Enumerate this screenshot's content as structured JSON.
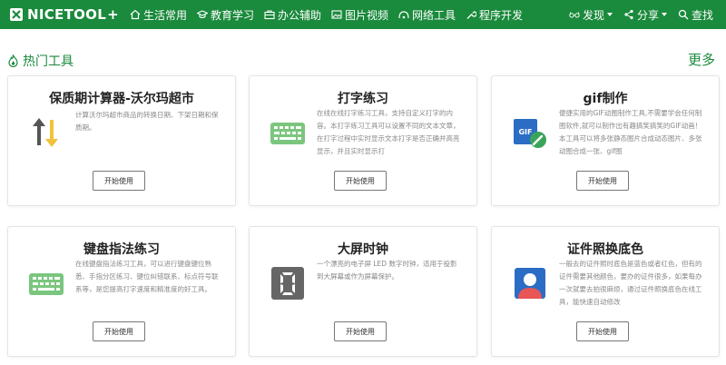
{
  "header": {
    "logo_text": "NICETOOL",
    "logo_plus": "+",
    "nav": [
      {
        "label": "生活常用"
      },
      {
        "label": "教育学习"
      },
      {
        "label": "办公辅助"
      },
      {
        "label": "图片视频"
      },
      {
        "label": "网络工具"
      },
      {
        "label": "程序开发"
      }
    ],
    "right": [
      {
        "label": "发现"
      },
      {
        "label": "分享"
      },
      {
        "label": "查找"
      }
    ]
  },
  "section": {
    "title": "热门工具",
    "more": "更多"
  },
  "cards": [
    {
      "title": "保质期计算器-沃尔玛超市",
      "desc": "计算沃尔玛超市商品的转换日期、下架日期和保质期。",
      "button": "开始使用",
      "icon": "up-down-arrows-icon"
    },
    {
      "title": "打字练习",
      "desc": "在线在线打字练习工具，支持自定义打字的内容。本打字练习工具可以设置不同的文本文章，在打字过程中实时显示文本打字是否正确并高亮显示，并且实时显示打",
      "button": "开始使用",
      "icon": "keyboard-icon"
    },
    {
      "title": "gif制作",
      "desc": "便捷实用的GIF动图制作工具,不需要学会任何制图软件,就可以制作出有趣搞笑搞笑的GIF动画！本工具可以将多张静态图片合成动态图片、多张动图合成一张、gif图",
      "button": "开始使用",
      "icon": "gif-icon"
    },
    {
      "title": "键盘指法练习",
      "desc": "在线键盘指法练习工具，可以进行键盘键位熟悉、手指分区练习、键位纠错联系、标点符号联系等，是您提高打字速度和精准度的好工具。",
      "button": "开始使用",
      "icon": "keyboard-icon"
    },
    {
      "title": "大屏时钟",
      "desc": "一个漂亮的电子屏 LED 数字时钟，适用于投影到大屏幕或作为屏幕保护。",
      "button": "开始使用",
      "icon": "led-digit-icon"
    },
    {
      "title": "证件照换底色",
      "desc": "一般去的证件照时底色是蓝色或者红色，但有的证件需要其他颜色，要办的证件很多，如果每办一次就要去拍很麻烦，通过证件照换底色在线工具，能快速自动修改",
      "button": "开始使用",
      "icon": "id-photo-icon"
    }
  ],
  "colors": {
    "brand": "#1a8a3c",
    "keyboard": "#7bc67e",
    "gif_blue": "#2b6cc4",
    "gif_green": "#3aa55a",
    "arrow_gray": "#555555",
    "arrow_yellow": "#f2c23a"
  }
}
